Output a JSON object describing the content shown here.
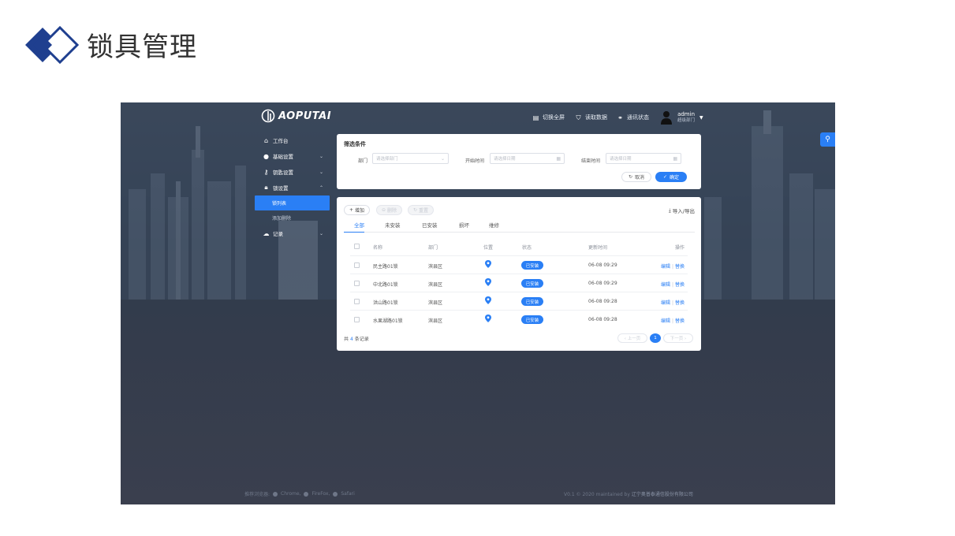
{
  "slide": {
    "title": "锁具管理"
  },
  "app": {
    "brand": "AOPUTAI",
    "top_actions": [
      {
        "label": "切换全屏",
        "icon": "fullscreen-icon"
      },
      {
        "label": "读取数据",
        "icon": "shield-icon"
      },
      {
        "label": "通讯状态",
        "icon": "link-icon"
      }
    ],
    "user": {
      "name": "admin",
      "dept": "超级部门"
    },
    "sidebar": [
      {
        "label": "工作台",
        "icon": "home-icon"
      },
      {
        "label": "基础设置",
        "icon": "settings-icon"
      },
      {
        "label": "钥匙设置",
        "icon": "key-icon"
      },
      {
        "label": "锁设置",
        "icon": "lock-icon"
      }
    ],
    "sidebar_sub": [
      {
        "label": "锁列表",
        "active": true
      },
      {
        "label": "添加删除",
        "active": false
      }
    ],
    "sidebar_last": {
      "label": "记录",
      "icon": "cloud-icon"
    },
    "filter": {
      "title": "筛选条件",
      "dept_label": "部门",
      "dept_placeholder": "请选择部门",
      "start_label": "开始时间",
      "start_placeholder": "请选择日期",
      "end_label": "结束时间",
      "end_placeholder": "请选择日期",
      "cancel_label": "取消",
      "ok_label": "确定"
    },
    "toolbar": {
      "add_label": "增加",
      "delete_label": "删除",
      "refresh_label": "重置",
      "io_label": "导入/导出"
    },
    "tabs": [
      "全部",
      "未安装",
      "已安装",
      "损坏",
      "维修"
    ],
    "table": {
      "headers": {
        "name": "名称",
        "dept": "部门",
        "location": "位置",
        "status": "状态",
        "updated": "更新时间",
        "ops": "操作"
      },
      "rows": [
        {
          "name": "民主路01锁",
          "dept": "滨县区",
          "status": "已安装",
          "updated": "06-08 09:29",
          "edit": "编辑",
          "replace": "替换"
        },
        {
          "name": "中北路01锁",
          "dept": "滨县区",
          "status": "已安装",
          "updated": "06-08 09:29",
          "edit": "编辑",
          "replace": "替换"
        },
        {
          "name": "洪山路01锁",
          "dept": "滨县区",
          "status": "已安装",
          "updated": "06-08 09:28",
          "edit": "编辑",
          "replace": "替换"
        },
        {
          "name": "水果湖路01锁",
          "dept": "滨县区",
          "status": "已安装",
          "updated": "06-08 09:28",
          "edit": "编辑",
          "replace": "替换"
        }
      ]
    },
    "pagination": {
      "total_prefix": "共",
      "total_count": "4",
      "total_suffix": "条记录",
      "prev_label": "‹ 上一页",
      "current_page": "1",
      "next_label": "下一页 ›"
    },
    "footer": {
      "browsers_label": "推荐浏览器:",
      "browsers": [
        "Chrome,",
        "FireFox,",
        "Safari"
      ],
      "copyright": "V0.1 © 2020 maintained by ",
      "company": "辽宁奥普泰通信股份有限公司"
    },
    "colors": {
      "accent": "#2a7ff5",
      "background": "#2f3b4d"
    }
  }
}
